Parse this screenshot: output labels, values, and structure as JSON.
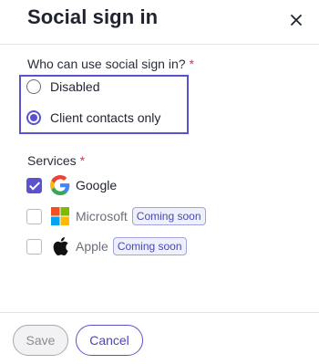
{
  "dialog": {
    "title": "Social sign in"
  },
  "access": {
    "label": "Who can use social sign in?",
    "required_mark": "*",
    "options": [
      {
        "label": "Disabled",
        "selected": false
      },
      {
        "label": "Client contacts only",
        "selected": true
      }
    ]
  },
  "services": {
    "label": "Services",
    "required_mark": "*",
    "items": [
      {
        "name": "Google",
        "checked": true,
        "icon": "google-logo-icon",
        "badge": ""
      },
      {
        "name": "Microsoft",
        "checked": false,
        "icon": "microsoft-logo-icon",
        "badge": "Coming soon"
      },
      {
        "name": "Apple",
        "checked": false,
        "icon": "apple-logo-icon",
        "badge": "Coming soon"
      }
    ]
  },
  "footer": {
    "save_label": "Save",
    "cancel_label": "Cancel"
  },
  "colors": {
    "accent": "#5a52cf",
    "required": "#e0354a"
  }
}
